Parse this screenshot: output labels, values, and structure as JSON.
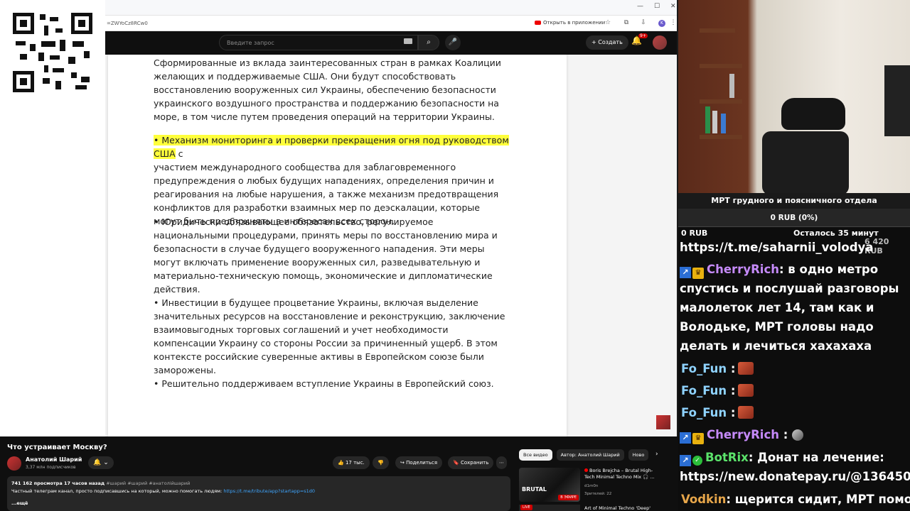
{
  "browser": {
    "url_fragment": "=ZWYoCz8RCw0",
    "open_in_app": "Открыть в приложении",
    "avatar_letter": "K"
  },
  "youtube_header": {
    "search_placeholder": "Введите запрос",
    "create_label": "Создать",
    "notifications_badge": "9+"
  },
  "document": {
    "paragraphs": [
      "• Возможные возможности ... многонационального силы Украины. Сформированные из вклада заинтересованных стран в рамках Коалиции желающих и поддерживаемые США. Они будут способствовать восстановлению вооруженных сил Украины, обеспечению безопасности украинского воздушного пространства и поддержанию безопасности на море, в том числе путем проведения операций на территории Украины.",
      "участием международного сообщества для заблаговременного предупреждения о любых будущих нападениях, определения причин и реагирования на любые нарушения, а также механизм предотвращения конфликтов для разработки взаимных мер по деэскалации, которые могут быть предприняты в интересах всех сторон.",
      "• Юридически обязывающее обязательство, регулируемое национальными процедурами, принять меры по восстановлению мира и безопасности в случае будущего вооруженного нападения. Эти меры могут включать применение вооруженных сил, разведывательную и материально-техническую помощь, экономические и дипломатические действия.",
      "• Инвестиции в будущее процветание Украины, включая выделение значительных ресурсов на восстановление и реконструкцию, заключение взаимовыгодных торговых соглашений и учет необходимости компенсации Украину со стороны России за причиненный ущерб. В этом контексте российские суверенные активы в Европейском союзе были заморожены.",
      "• Решительно поддерживаем вступление Украины в Европейский союз."
    ],
    "highlight": "• Механизм мониторинга и проверки прекращения огня под руководством США",
    "highlight_tail": " с"
  },
  "video": {
    "title": "Что устраивает Москву?",
    "channel": "Анатолий Шарий",
    "subscribers": "3,37 млн подписчиков",
    "likes": "17 тыс.",
    "share": "Поделиться",
    "save": "Сохранить",
    "stats": "741 162 просмотра  17 часов назад",
    "tags": "#шарий #шарий #анатолійшарий",
    "desc_line": "Частный телеграм канал, просто подписавшись на который, можно помогать людям:",
    "desc_link": "https://t.me/tribute/app?startapp=s1d0",
    "more": "...ещё"
  },
  "sidebar_chips": [
    "Все видео",
    "Автор: Анатолий Шарий",
    "Ново"
  ],
  "recommended": {
    "title": "Boris Brejcha – Brutal High-Tech Minimal Techno Mix 🎧 ...",
    "channel": "d1m0n",
    "viewers": "Зрителей: 22",
    "badge": "В ЭФИРЕ",
    "logo_text": "BRUTAL",
    "next_title": "Art of Minimal Techno 'Deep'",
    "next_badge": "LIVE"
  },
  "donation": {
    "title": "МРТ грудного и поясничного отдела",
    "progress": "0 RUB (0%)",
    "min": "0 RUB",
    "remaining": "Осталось 35 минут",
    "goal": "6 420 RUB"
  },
  "chat": {
    "link": "https://t.me/saharnii_volodya",
    "m1_user": "CherryRich",
    "m1_text": ": в одно метро спустись и послушай разговоры малолеток лет 14, там как и Володьке, МРТ головы надо делать и лечиться хахахаха",
    "m2_user": "Fo_Fun",
    "m5_user": "CherryRich",
    "m6_user": "BotRix",
    "m6_text": ": Донат на лечение: https://new.donatepay.ru/@1364501",
    "m7_user": "Vodkin",
    "m7_text": ": щерится сидит, МРТ помогло",
    "colon": " :",
    "colors": {
      "cherry": "#c58af9",
      "fofun": "#8fd3ff",
      "botrix": "#5be36b",
      "vodkin": "#e7a64a"
    }
  }
}
